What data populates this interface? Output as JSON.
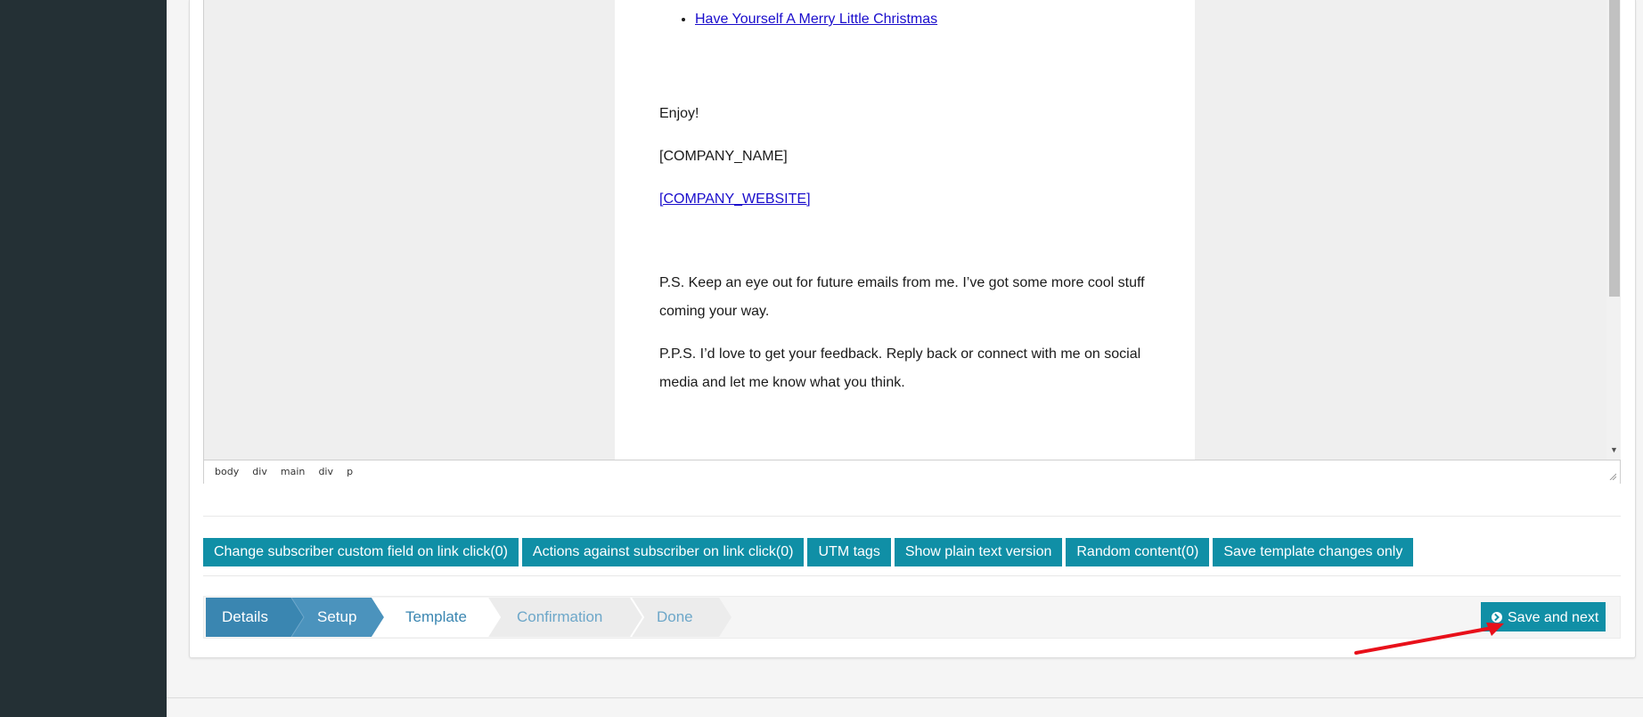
{
  "email": {
    "list_item": "Have Yourself A Merry Little Christmas",
    "enjoy": "Enjoy!",
    "company_name": "[COMPANY_NAME]",
    "company_website": "[COMPANY_WEBSITE]",
    "ps_line1": "P.S. Keep an eye out for future emails from me. I’ve got some more cool stuff",
    "ps_line2": "coming your way.",
    "pps_line1": "P.P.S. I’d love to get your feedback. Reply back or connect with me on social",
    "pps_line2": "media and let me know what you think."
  },
  "statusbar": {
    "path": [
      "body",
      "div",
      "main",
      "div",
      "p"
    ]
  },
  "toolbar": {
    "buttons": [
      "Change subscriber custom field on link click(0)",
      "Actions against subscriber on link click(0)",
      "UTM tags",
      "Show plain text version",
      "Random content(0)",
      "Save template changes only"
    ]
  },
  "wizard": {
    "steps": [
      "Details",
      "Setup",
      "Template",
      "Confirmation",
      "Done"
    ],
    "colors": {
      "done_dark": "#3a86b1",
      "done_mid": "#4b93bd",
      "current_text": "#3a86b1",
      "pending_text": "#6da7c9",
      "pending_bg": "#ececec"
    },
    "save_next_label": "Save and next"
  },
  "colors": {
    "sidebar": "#243035",
    "button": "#108fa6",
    "arrow": "#e8101a"
  }
}
